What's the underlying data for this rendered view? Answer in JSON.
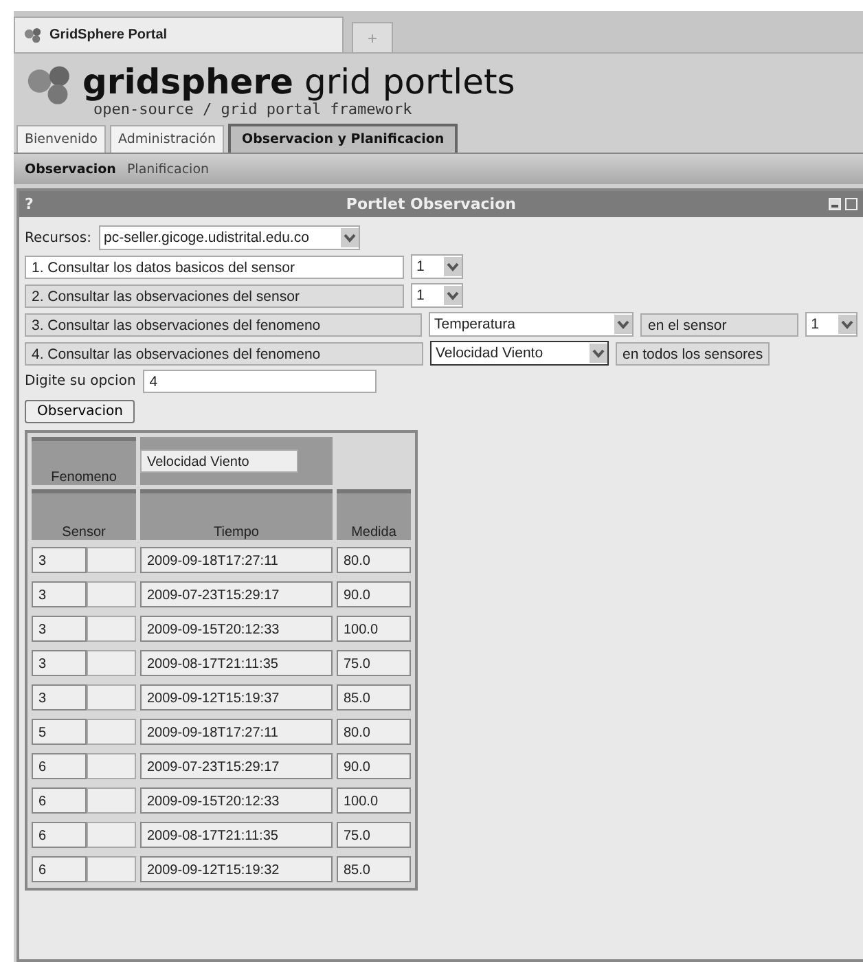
{
  "browser_tab": {
    "title": "GridSphere Portal",
    "new_tab": "+"
  },
  "header": {
    "brand_bold": "gridsphere",
    "brand_rest": "grid portlets",
    "tagline": "open-source / grid portal framework"
  },
  "tabs": [
    {
      "label": "Bienvenido",
      "selected": false
    },
    {
      "label": "Administración",
      "selected": false
    },
    {
      "label": "Observacion y Planificacion",
      "selected": true
    }
  ],
  "subtabs": [
    {
      "label": "Observacion",
      "selected": true
    },
    {
      "label": "Planificacion",
      "selected": false
    }
  ],
  "portlet": {
    "help": "?",
    "title": "Portlet Observacion"
  },
  "resource": {
    "label": "Recursos:",
    "value": "pc-seller.gicoge.udistrital.edu.co"
  },
  "options": [
    {
      "label": "1. Consultar los datos basicos del sensor",
      "highlighted": true,
      "controls": [
        {
          "kind": "select",
          "value": "1"
        }
      ]
    },
    {
      "label": "2. Consultar las observaciones del sensor",
      "highlighted": false,
      "controls": [
        {
          "kind": "select",
          "value": "1"
        }
      ]
    },
    {
      "label": "3. Consultar las observaciones del fenomeno",
      "highlighted": false,
      "controls": [
        {
          "kind": "select",
          "value": "Temperatura"
        },
        {
          "kind": "text",
          "value": "en el sensor"
        },
        {
          "kind": "select",
          "value": "1"
        }
      ]
    },
    {
      "label": "4. Consultar las observaciones del fenomeno",
      "highlighted": false,
      "controls": [
        {
          "kind": "select",
          "value": "Velocidad Viento"
        },
        {
          "kind": "text",
          "value": "en todos los sensores"
        }
      ]
    }
  ],
  "entry": {
    "label": "Digite su opcion",
    "value": "4"
  },
  "button": "Observacion",
  "table": {
    "phenomenon_label": "Fenomeno",
    "phenomenon": "Velocidad Viento",
    "columns": [
      "Sensor",
      "Tiempo",
      "Medida"
    ],
    "rows": [
      [
        "3",
        "2009-09-18T17:27:11",
        "80.0"
      ],
      [
        "3",
        "2009-07-23T15:29:17",
        "90.0"
      ],
      [
        "3",
        "2009-09-15T20:12:33",
        "100.0"
      ],
      [
        "3",
        "2009-08-17T21:11:35",
        "75.0"
      ],
      [
        "3",
        "2009-09-12T15:19:37",
        "85.0"
      ],
      [
        "5",
        "2009-09-18T17:27:11",
        "80.0"
      ],
      [
        "6",
        "2009-07-23T15:29:17",
        "90.0"
      ],
      [
        "6",
        "2009-09-15T20:12:33",
        "100.0"
      ],
      [
        "6",
        "2009-08-17T21:11:35",
        "75.0"
      ],
      [
        "6",
        "2009-09-12T15:19:32",
        "85.0"
      ]
    ]
  }
}
